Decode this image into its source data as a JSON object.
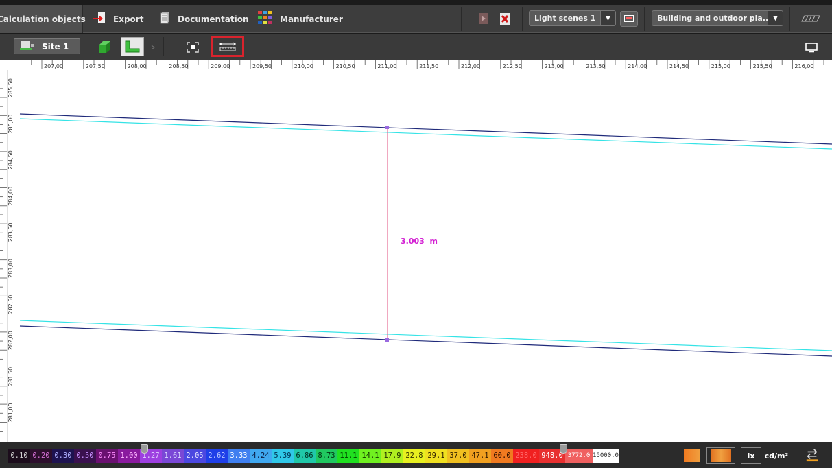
{
  "toolbar": {
    "calc_tab": "Calculation objects",
    "export_label": "Export",
    "documentation_label": "Documentation",
    "manufacturer_label": "Manufacturer",
    "light_scenes_value": "Light scenes 1",
    "plan_view_value": "Building and outdoor pla..."
  },
  "subbar": {
    "site_label": "Site 1"
  },
  "ruler": {
    "x_ticks": [
      "207,00",
      "207,50",
      "208,00",
      "208,50",
      "209,00",
      "209,50",
      "210,00",
      "210,50",
      "211,00",
      "211,50",
      "212,00",
      "212,50",
      "213,00",
      "213,50",
      "214,00",
      "214,50",
      "215,00",
      "215,50",
      "216,00"
    ],
    "y_ticks": [
      "285,50",
      "285,00",
      "284,50",
      "284,00",
      "283,50",
      "283,00",
      "282,50",
      "282,00",
      "281,50",
      "281,00"
    ]
  },
  "measurement": {
    "value": "3.003",
    "unit": "m"
  },
  "legend": {
    "values": [
      {
        "label": "0.10",
        "bg": "#1c0d1c",
        "fg": "#cfcfcf"
      },
      {
        "label": "0.20",
        "bg": "#2d0f2d",
        "fg": "#d470d4"
      },
      {
        "label": "0.30",
        "bg": "#1e1350",
        "fg": "#b0b0ff"
      },
      {
        "label": "0.50",
        "bg": "#3a114e",
        "fg": "#c890ff"
      },
      {
        "label": "0.75",
        "bg": "#6a1070",
        "fg": "#ff8cff"
      },
      {
        "label": "1.00",
        "bg": "#8a1a9e",
        "fg": "#ffb8ff"
      },
      {
        "label": "1.27",
        "bg": "#9d3fe0",
        "fg": "#e0d0ff"
      },
      {
        "label": "1.61",
        "bg": "#7a48d6",
        "fg": "#d8d8ff"
      },
      {
        "label": "2.05",
        "bg": "#4c48e0",
        "fg": "#e8e8ff"
      },
      {
        "label": "2.62",
        "bg": "#1f3fe8",
        "fg": "#b8c8ff"
      },
      {
        "label": "3.33",
        "bg": "#3f7ff0",
        "fg": "#ffffff"
      },
      {
        "label": "4.24",
        "bg": "#40a8f0",
        "fg": "#0a1a40"
      },
      {
        "label": "5.39",
        "bg": "#30c8e8",
        "fg": "#003050"
      },
      {
        "label": "6.86",
        "bg": "#20c8a8",
        "fg": "#003020"
      },
      {
        "label": "8.73",
        "bg": "#20c860",
        "fg": "#003010"
      },
      {
        "label": "11.1",
        "bg": "#20e020",
        "fg": "#004000"
      },
      {
        "label": "14.1",
        "bg": "#70f020",
        "fg": "#103000"
      },
      {
        "label": "17.9",
        "bg": "#b0f020",
        "fg": "#203000"
      },
      {
        "label": "22.8",
        "bg": "#e8f020",
        "fg": "#303000"
      },
      {
        "label": "29.1",
        "bg": "#f0e020",
        "fg": "#302000"
      },
      {
        "label": "37.0",
        "bg": "#f0c020",
        "fg": "#302000"
      },
      {
        "label": "47.1",
        "bg": "#f0a020",
        "fg": "#301800"
      },
      {
        "label": "60.0",
        "bg": "#f07a20",
        "fg": "#301000"
      },
      {
        "label": "238.0",
        "bg": "#f02020",
        "fg": "#ff6a6a"
      },
      {
        "label": "948.0",
        "bg": "#e83030",
        "fg": "#ffffff"
      },
      {
        "label": "3772.0",
        "bg": "#f06060",
        "fg": "#ffffff"
      },
      {
        "label": "15000.0",
        "bg": "#ffffff",
        "fg": "#303030"
      }
    ],
    "unit_lx": "lx",
    "unit_cd": "cd/m²"
  },
  "colors": {
    "line_navy": "#1f2a7a",
    "line_cyan": "#35e3e6",
    "measure_line": "#e05080",
    "measure_point": "#9b6ae0",
    "measure_text": "#d21fd2",
    "highlight": "#d9232d"
  }
}
